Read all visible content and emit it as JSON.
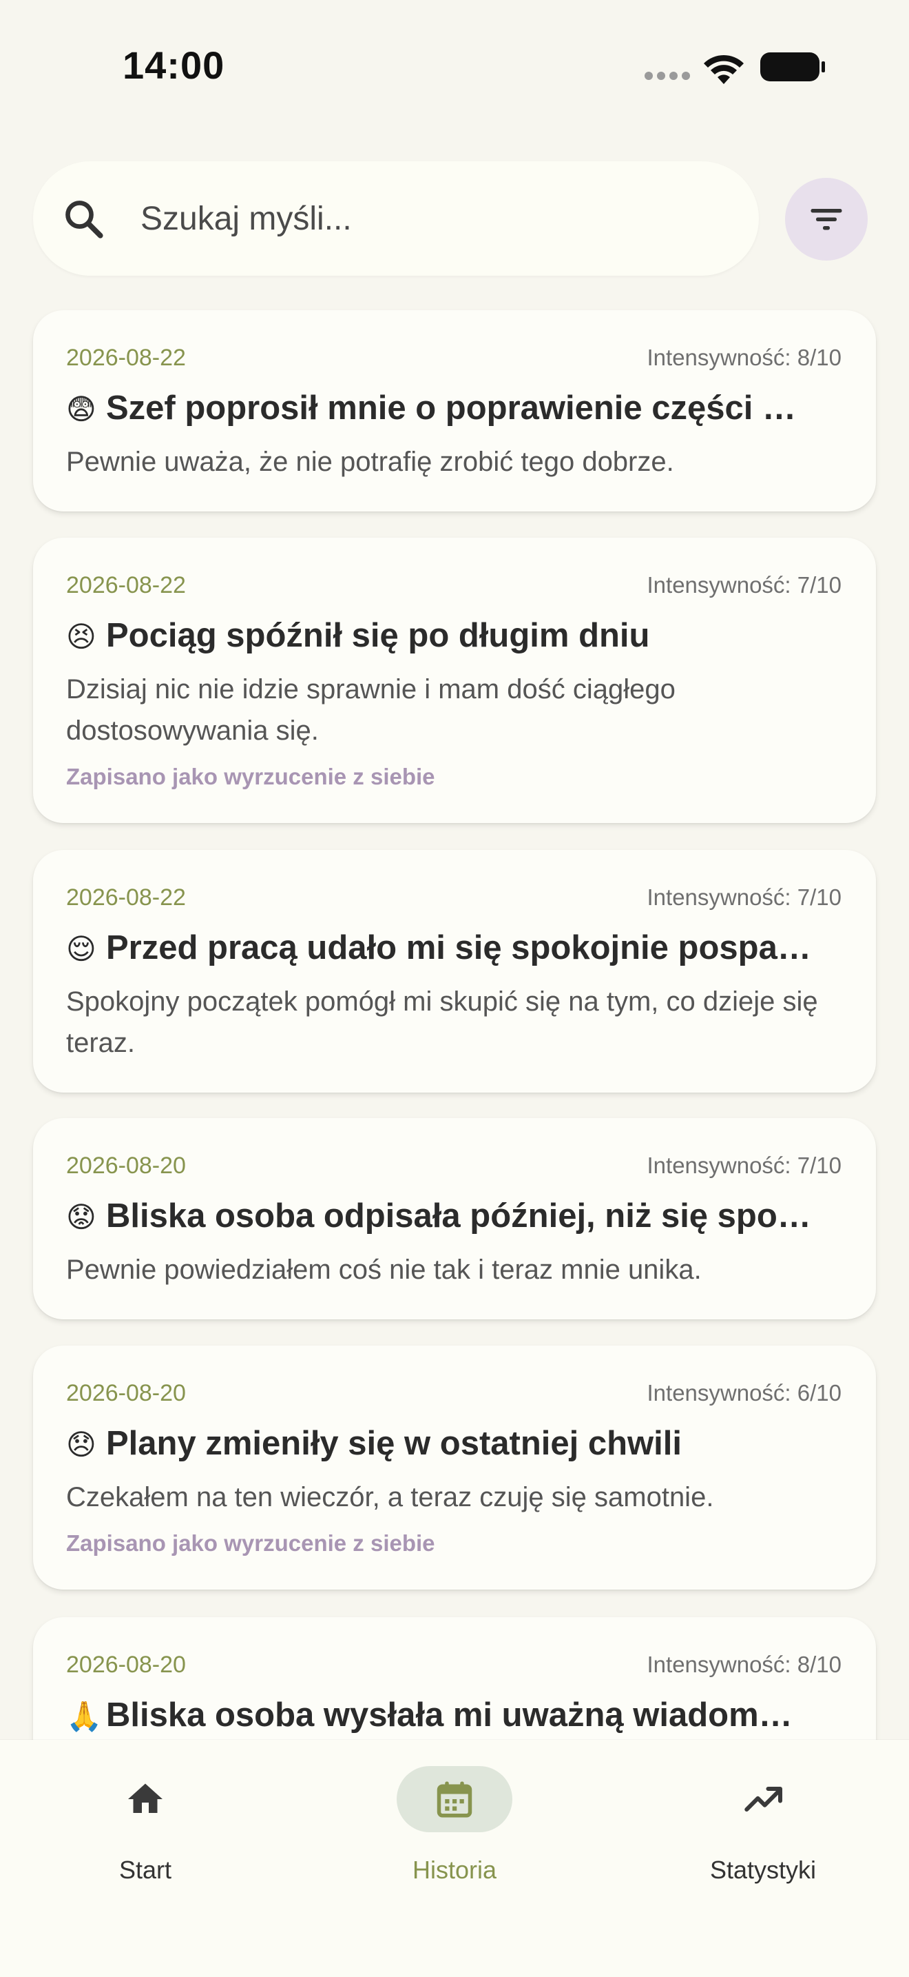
{
  "status_bar": {
    "time": "14:00"
  },
  "search": {
    "placeholder": "Szukaj myśli..."
  },
  "entries": [
    {
      "date": "2026-08-22",
      "intensity": "Intensywność: 8/10",
      "emoji": "😨",
      "title": "Szef poprosił mnie o poprawienie części …",
      "body": "Pewnie uważa, że nie potrafię zrobić tego dobrze.",
      "tag": ""
    },
    {
      "date": "2026-08-22",
      "intensity": "Intensywność: 7/10",
      "emoji": "😣",
      "title": "Pociąg spóźnił się po długim dniu",
      "body": "Dzisiaj nic nie idzie sprawnie i mam dość ciągłego dostosowywania się.",
      "tag": "Zapisano jako wyrzucenie z siebie"
    },
    {
      "date": "2026-08-22",
      "intensity": "Intensywność: 7/10",
      "emoji": "😌",
      "title": "Przed pracą udało mi się spokojnie pospa…",
      "body": "Spokojny początek pomógł mi skupić się na tym, co dzieje się teraz.",
      "tag": ""
    },
    {
      "date": "2026-08-20",
      "intensity": "Intensywność: 7/10",
      "emoji": "😟",
      "title": "Bliska osoba odpisała później, niż się spo…",
      "body": "Pewnie powiedziałem coś nie tak i teraz mnie unika.",
      "tag": ""
    },
    {
      "date": "2026-08-20",
      "intensity": "Intensywność: 6/10",
      "emoji": "😞",
      "title": "Plany zmieniły się w ostatniej chwili",
      "body": "Czekałem na ten wieczór, a teraz czuję się samotnie.",
      "tag": "Zapisano jako wyrzucenie z siebie"
    },
    {
      "date": "2026-08-20",
      "intensity": "Intensywność: 8/10",
      "emoji": "🙏",
      "title": "Bliska osoba wysłała mi uważną wiadom…",
      "body": "",
      "tag": ""
    }
  ],
  "nav": {
    "items": [
      {
        "label": "Start",
        "icon": "home-icon",
        "active": false
      },
      {
        "label": "Historia",
        "icon": "calendar-icon",
        "active": true
      },
      {
        "label": "Statystyki",
        "icon": "trending-up-icon",
        "active": false
      }
    ],
    "active_color": "#87944E"
  }
}
